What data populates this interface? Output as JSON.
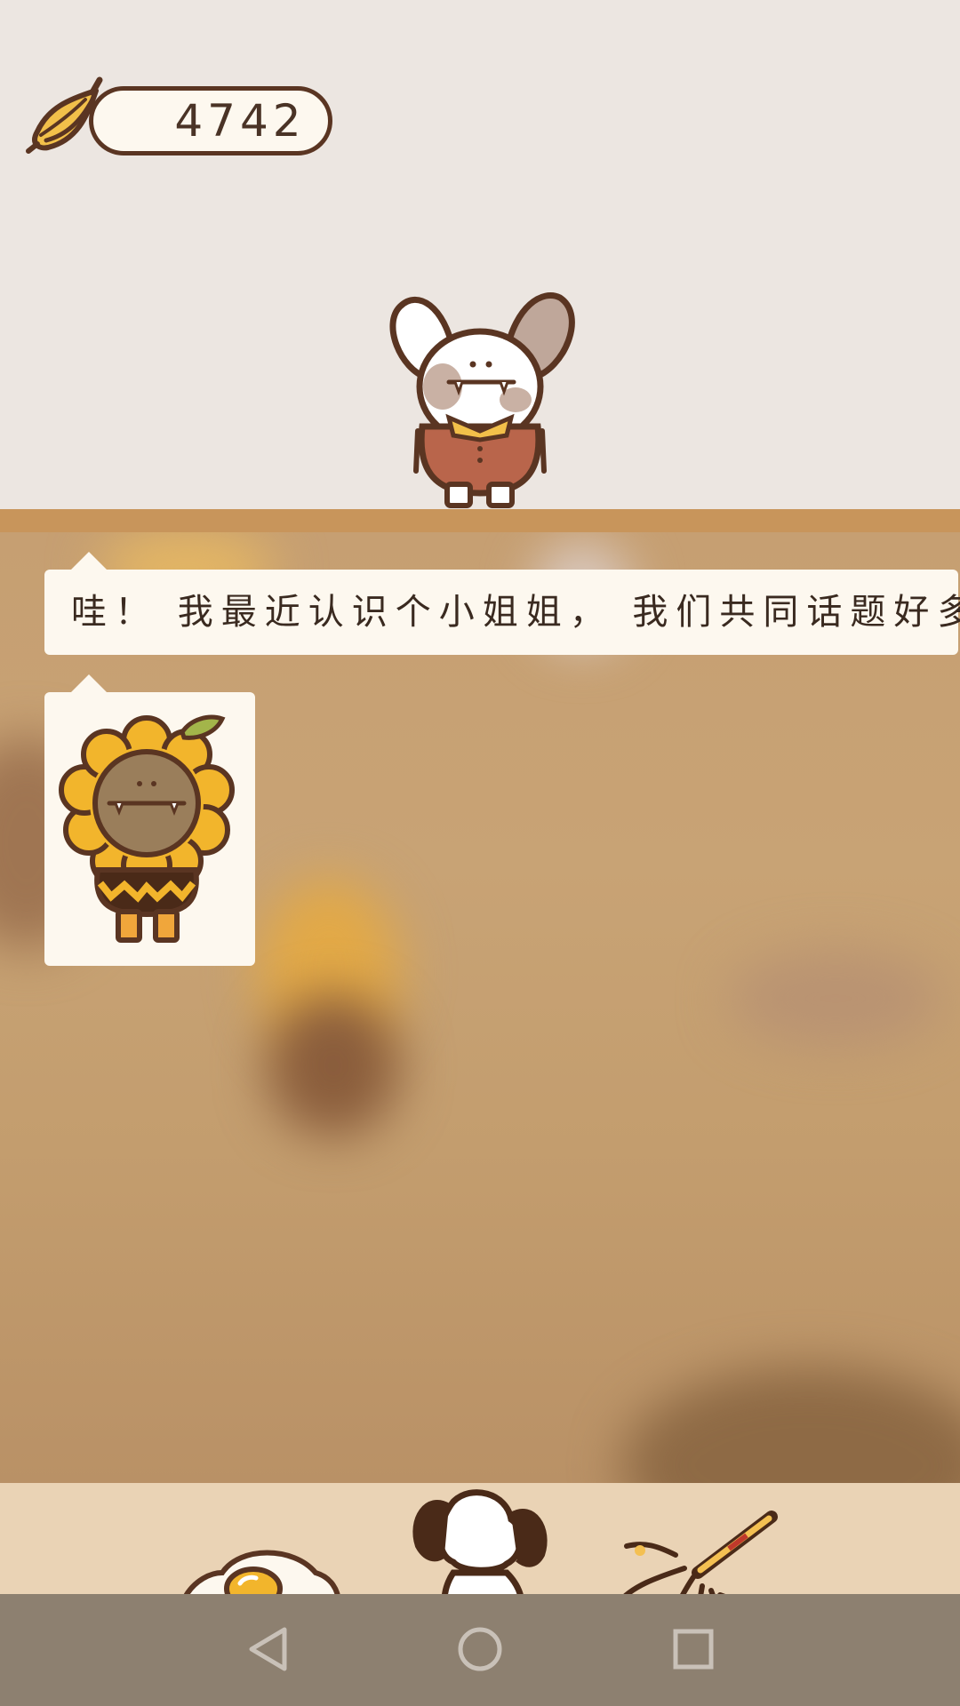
{
  "currency": {
    "icon": "banana-icon",
    "value": "4742"
  },
  "characters": {
    "main": "rabbit-character",
    "speaker_portrait": "sunflower-character"
  },
  "dialogue": {
    "text": "哇！ 我最近认识个小姐姐， 我们共同话题好多"
  },
  "toolbar": {
    "items": [
      "fried-egg-icon",
      "girl-character-icon",
      "firework-icon"
    ]
  },
  "system_nav": {
    "items": [
      "back-icon",
      "home-icon",
      "recents-icon"
    ]
  },
  "colors": {
    "top_background": "#ece6e1",
    "shelf": "#c8955b",
    "bubble": "#fdf8ef",
    "outline": "#5a3522",
    "toolbar": "#ead3b5",
    "nav": "#8d8070"
  }
}
